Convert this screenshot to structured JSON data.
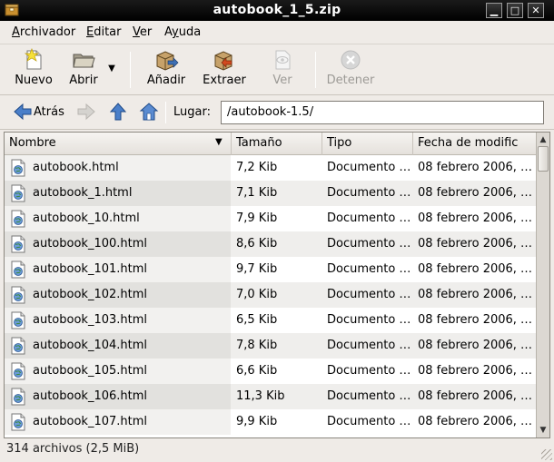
{
  "window": {
    "title": "autobook_1_5.zip"
  },
  "menu": {
    "items": [
      {
        "label": "Archivador",
        "mnemonic_index": 0
      },
      {
        "label": "Editar",
        "mnemonic_index": 0
      },
      {
        "label": "Ver",
        "mnemonic_index": 0
      },
      {
        "label": "Ayuda",
        "mnemonic_index": 1
      }
    ]
  },
  "toolbar": {
    "new_label": "Nuevo",
    "open_label": "Abrir",
    "add_label": "Añadir",
    "extract_label": "Extraer",
    "view_label": "Ver",
    "stop_label": "Detener"
  },
  "location": {
    "back_label": "Atrás",
    "label": "Lugar:",
    "path": "/autobook-1.5/"
  },
  "columns": {
    "name": "Nombre",
    "size": "Tamaño",
    "type": "Tipo",
    "date": "Fecha de modific"
  },
  "files": [
    {
      "name": "autobook.html",
      "size": "7,2 Kib",
      "type": "Documento …",
      "date": "08 febrero 2006, …"
    },
    {
      "name": "autobook_1.html",
      "size": "7,1 Kib",
      "type": "Documento …",
      "date": "08 febrero 2006, …"
    },
    {
      "name": "autobook_10.html",
      "size": "7,9 Kib",
      "type": "Documento …",
      "date": "08 febrero 2006, …"
    },
    {
      "name": "autobook_100.html",
      "size": "8,6 Kib",
      "type": "Documento …",
      "date": "08 febrero 2006, …"
    },
    {
      "name": "autobook_101.html",
      "size": "9,7 Kib",
      "type": "Documento …",
      "date": "08 febrero 2006, …"
    },
    {
      "name": "autobook_102.html",
      "size": "7,0 Kib",
      "type": "Documento …",
      "date": "08 febrero 2006, …"
    },
    {
      "name": "autobook_103.html",
      "size": "6,5 Kib",
      "type": "Documento …",
      "date": "08 febrero 2006, …"
    },
    {
      "name": "autobook_104.html",
      "size": "7,8 Kib",
      "type": "Documento …",
      "date": "08 febrero 2006, …"
    },
    {
      "name": "autobook_105.html",
      "size": "6,6 Kib",
      "type": "Documento …",
      "date": "08 febrero 2006, …"
    },
    {
      "name": "autobook_106.html",
      "size": "11,3 Kib",
      "type": "Documento …",
      "date": "08 febrero 2006, …"
    },
    {
      "name": "autobook_107.html",
      "size": "9,9 Kib",
      "type": "Documento …",
      "date": "08 febrero 2006, …"
    }
  ],
  "status": {
    "text": "314 archivos (2,5 MiB)"
  }
}
